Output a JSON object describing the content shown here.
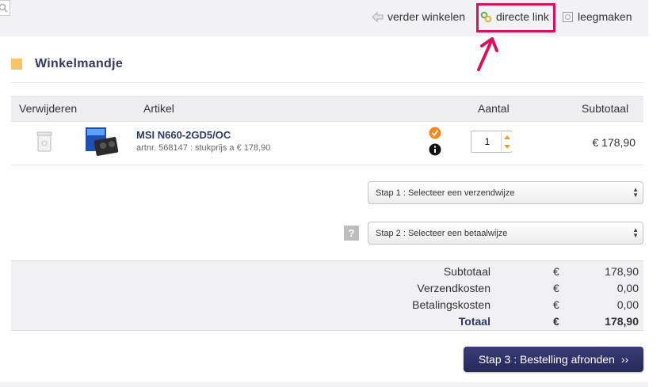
{
  "toplinks": {
    "continue_shopping": "verder winkelen",
    "direct_link": "directe link",
    "empty_cart": "leegmaken"
  },
  "page": {
    "title": "Winkelmandje"
  },
  "table": {
    "headers": {
      "remove": "Verwijderen",
      "article": "Artikel",
      "quantity": "Aantal",
      "subtotal": "Subtotaal"
    },
    "rows": [
      {
        "name": "MSI N660-2GD5/OC",
        "meta": "artnr. 568147 : stukprijs a € 178,90",
        "quantity": "1",
        "subtotal": "€ 178,90"
      }
    ]
  },
  "shipping_select": {
    "label": "Stap 1 : Selecteer een verzendwijze"
  },
  "payment_select": {
    "label": "Stap 2 : Selecteer een betaalwijze",
    "help": "?"
  },
  "totals": {
    "rows": [
      {
        "label": "Subtotaal",
        "currency": "€",
        "value": "178,90"
      },
      {
        "label": "Verzendkosten",
        "currency": "€",
        "value": "0,00"
      },
      {
        "label": "Betalingskosten",
        "currency": "€",
        "value": "0,00"
      },
      {
        "label": "Totaal",
        "currency": "€",
        "value": "178,90"
      }
    ]
  },
  "checkout": {
    "label": "Stap 3 : Bestelling afronden",
    "chevron": "››"
  },
  "colors": {
    "accent_square": "#f7c46c",
    "title": "#2f3a5e",
    "highlight": "#d6135e",
    "button": "#2c2f66"
  }
}
